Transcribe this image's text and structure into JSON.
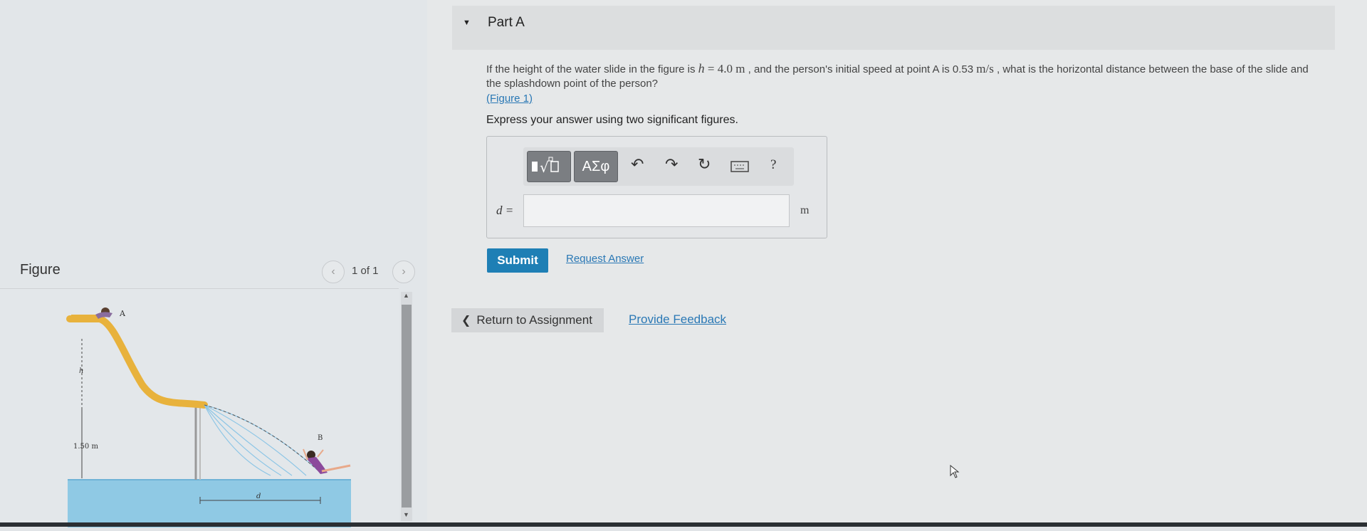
{
  "part_a": {
    "title": "Part A"
  },
  "question": {
    "text_before": "If the height of the water slide in the figure is ",
    "h_var": "h",
    "h_value": " = 4.0 ",
    "h_unit": "m",
    "text_middle": " , and the person's initial speed at point A is 0.53 ",
    "speed_unit": "m/s",
    "text_after": " , what is the horizontal distance between the base of the slide and the splashdown point of the person?",
    "figure_link": "(Figure 1)",
    "instruction": "Express your answer using two significant figures."
  },
  "toolbar": {
    "symbols_label": "ΑΣφ",
    "help_label": "?"
  },
  "answer": {
    "variable_label": "d =",
    "value": "",
    "unit": "m"
  },
  "actions": {
    "submit_label": "Submit",
    "request_answer_label": "Request Answer",
    "return_label": "Return to Assignment",
    "feedback_label": "Provide Feedback"
  },
  "figure": {
    "heading": "Figure",
    "page_indicator": "1 of 1",
    "label_a": "A",
    "label_b": "B",
    "label_h": "h",
    "label_height": "1.50 m",
    "label_d": "d"
  },
  "colors": {
    "accent": "#1e7fb5",
    "link": "#2a78b5",
    "slide": "#e8b23c",
    "water": "#8fc9e4"
  }
}
